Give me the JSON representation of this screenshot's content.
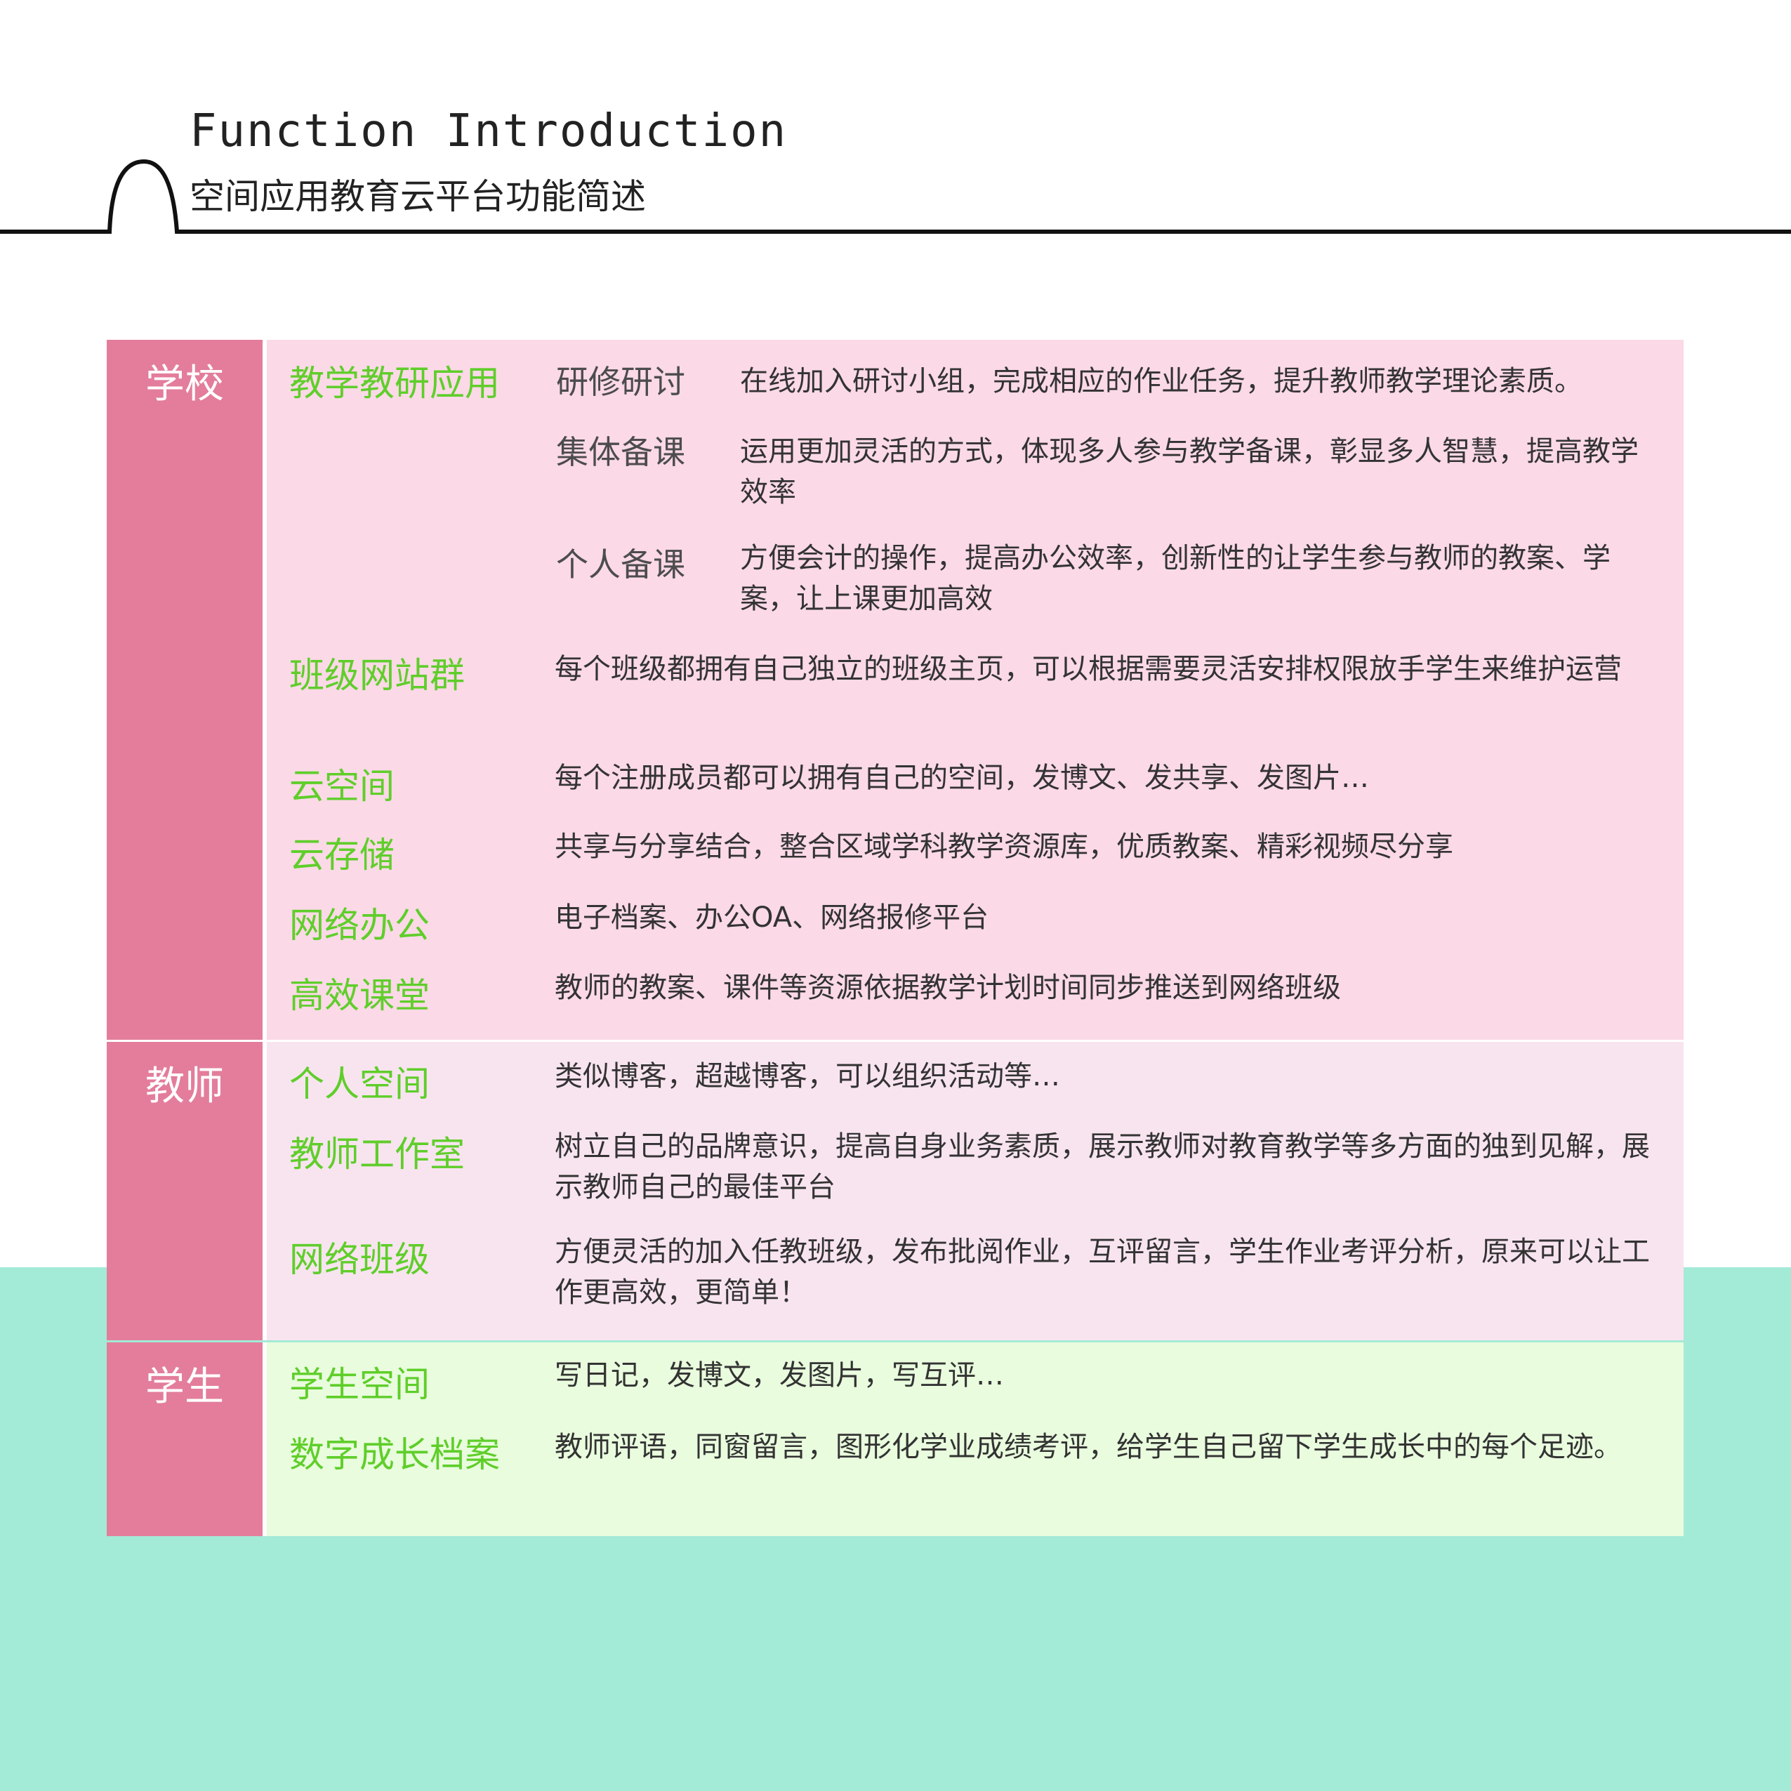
{
  "header": {
    "title": "Function Introduction",
    "subtitle": "空间应用教育云平台功能简述"
  },
  "colors": {
    "category_bg": "#e37d9b",
    "school_bg": "#fbd9e7",
    "teacher_bg": "#f8e4ef",
    "student_bg": "#e9fcde",
    "function_text": "#5fce2a",
    "teal_band": "#a3ead7"
  },
  "sections": {
    "school": {
      "label": "学校",
      "teaching": {
        "name": "教学教研应用",
        "items": [
          {
            "name": "研修研讨",
            "desc": "在线加入研讨小组，完成相应的作业任务，提升教师教学理论素质。"
          },
          {
            "name": "集体备课",
            "desc": "运用更加灵活的方式，体现多人参与教学备课，彰显多人智慧，提高教学效率"
          },
          {
            "name": "个人备课",
            "desc": "方便会计的操作，提高办公效率，创新性的让学生参与教师的教案、学案，让上课更加高效"
          }
        ]
      },
      "functions": [
        {
          "name": "班级网站群",
          "desc": "每个班级都拥有自己独立的班级主页，可以根据需要灵活安排权限放手学生来维护运营"
        },
        {
          "name": "云空间",
          "desc": "每个注册成员都可以拥有自己的空间，发博文、发共享、发图片…"
        },
        {
          "name": "云存储",
          "desc": "共享与分享结合，整合区域学科教学资源库，优质教案、精彩视频尽分享"
        },
        {
          "name": "网络办公",
          "desc": "电子档案、办公OA、网络报修平台"
        },
        {
          "name": "高效课堂",
          "desc": "教师的教案、课件等资源依据教学计划时间同步推送到网络班级"
        }
      ]
    },
    "teacher": {
      "label": "教师",
      "functions": [
        {
          "name": "个人空间",
          "desc": "类似博客，超越博客，可以组织活动等…"
        },
        {
          "name": "教师工作室",
          "desc": "树立自己的品牌意识，提高自身业务素质，展示教师对教育教学等多方面的独到见解，展示教师自己的最佳平台"
        },
        {
          "name": "网络班级",
          "desc": "方便灵活的加入任教班级，发布批阅作业，互评留言，学生作业考评分析，原来可以让工作更高效，更简单！"
        }
      ]
    },
    "student": {
      "label": "学生",
      "functions": [
        {
          "name": "学生空间",
          "desc": "写日记，发博文，发图片，写互评…"
        },
        {
          "name": "数字成长档案",
          "desc": "教师评语，同窗留言，图形化学业成绩考评，给学生自己留下学生成长中的每个足迹。"
        }
      ]
    }
  }
}
